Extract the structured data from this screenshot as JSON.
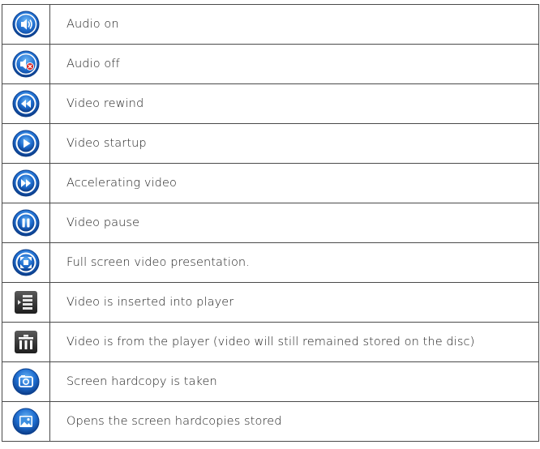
{
  "rows": [
    {
      "icon": "audio-on-icon",
      "label": "Audio on"
    },
    {
      "icon": "audio-off-icon",
      "label": "Audio off"
    },
    {
      "icon": "video-rewind-icon",
      "label": "Video rewind"
    },
    {
      "icon": "video-play-icon",
      "label": "Video startup"
    },
    {
      "icon": "video-fast-forward-icon",
      "label": "Accelerating video"
    },
    {
      "icon": "video-pause-icon",
      "label": "Video pause"
    },
    {
      "icon": "fullscreen-icon",
      "label": "Full screen video presentation."
    },
    {
      "icon": "insert-into-player-icon",
      "label": "Video is inserted into player"
    },
    {
      "icon": "trash-icon",
      "label": "Video is from the player (video will still remained stored on the disc)"
    },
    {
      "icon": "camera-icon",
      "label": "Screen hardcopy is taken"
    },
    {
      "icon": "image-gallery-icon",
      "label": "Opens the screen hardcopies stored"
    }
  ],
  "colors": {
    "icon_blue_dark": "#0b3e8c",
    "icon_blue_light": "#3d8fe0",
    "icon_blue_ring": "#1e64c4",
    "icon_gray_dark": "#2e2e2e",
    "border": "#4a4a4a",
    "text": "#222222"
  }
}
